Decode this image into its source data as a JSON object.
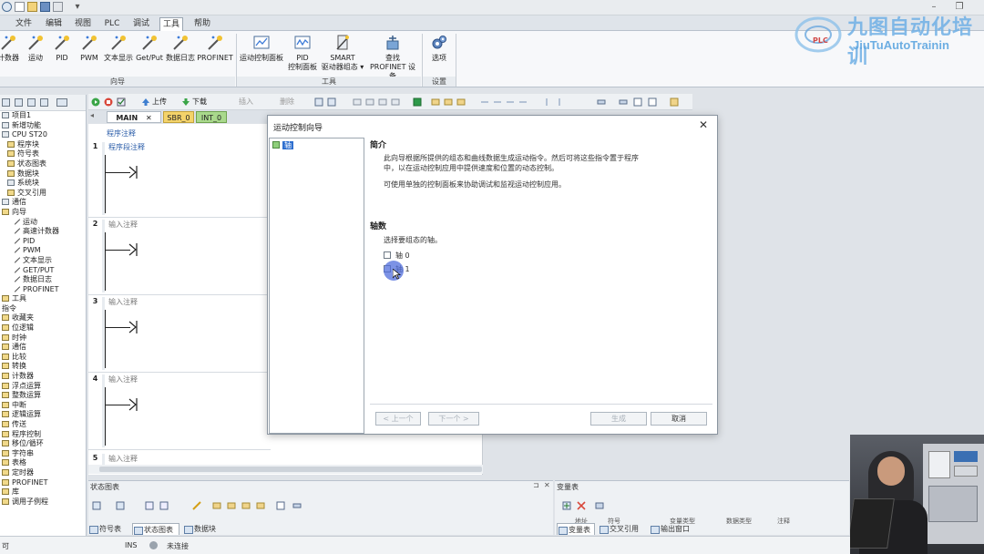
{
  "menu": {
    "tabs": [
      "文件",
      "编辑",
      "视图",
      "PLC",
      "调试",
      "工具",
      "帮助"
    ],
    "active_tab": "工具"
  },
  "ribbon": {
    "wizard_buttons": [
      "计数器",
      "运动",
      "PID",
      "PWM",
      "文本显示",
      "Get/Put",
      "数据日志",
      "PROFINET"
    ],
    "tool_buttons": [
      {
        "line1": "运动控制面板",
        "line2": ""
      },
      {
        "line1": "PID",
        "line2": "控制面板"
      },
      {
        "line1": "SMART",
        "line2": "驱动器组态 ▾"
      },
      {
        "line1": "查找",
        "line2": "PROFINET 设备"
      }
    ],
    "settings_button": "选项",
    "groups": [
      "向导",
      "工具",
      "设置"
    ]
  },
  "logo": {
    "cn": "九图自动化培训",
    "en": "JiuTuAutoTrainin",
    "badge": "PLC"
  },
  "left_tree": {
    "items": [
      {
        "label": "项目1",
        "indent": 0,
        "icon": "plain"
      },
      {
        "label": "新增功能",
        "indent": 0,
        "icon": "plain"
      },
      {
        "label": "CPU ST20",
        "indent": 0,
        "icon": "plain"
      },
      {
        "label": "程序块",
        "indent": 1,
        "icon": "folder"
      },
      {
        "label": "符号表",
        "indent": 1,
        "icon": "folder"
      },
      {
        "label": "状态图表",
        "indent": 1,
        "icon": "folder"
      },
      {
        "label": "数据块",
        "indent": 1,
        "icon": "folder"
      },
      {
        "label": "系统块",
        "indent": 1,
        "icon": "plain"
      },
      {
        "label": "交叉引用",
        "indent": 1,
        "icon": "folder"
      },
      {
        "label": "通信",
        "indent": 0,
        "icon": "plain"
      },
      {
        "label": "向导",
        "indent": 0,
        "icon": "folder"
      },
      {
        "label": "运动",
        "indent": 2,
        "icon": "wand"
      },
      {
        "label": "高速计数器",
        "indent": 2,
        "icon": "wand"
      },
      {
        "label": "PID",
        "indent": 2,
        "icon": "wand"
      },
      {
        "label": "PWM",
        "indent": 2,
        "icon": "wand"
      },
      {
        "label": "文本显示",
        "indent": 2,
        "icon": "wand"
      },
      {
        "label": "GET/PUT",
        "indent": 2,
        "icon": "wand"
      },
      {
        "label": "数据日志",
        "indent": 2,
        "icon": "wand"
      },
      {
        "label": "PROFINET",
        "indent": 2,
        "icon": "wand"
      },
      {
        "label": "工具",
        "indent": 0,
        "icon": "folder"
      },
      {
        "label": "指令",
        "indent": 0,
        "icon": "none"
      },
      {
        "label": "收藏夹",
        "indent": 0,
        "icon": "folder"
      },
      {
        "label": "位逻辑",
        "indent": 0,
        "icon": "folder"
      },
      {
        "label": "时钟",
        "indent": 0,
        "icon": "folder"
      },
      {
        "label": "通信",
        "indent": 0,
        "icon": "folder"
      },
      {
        "label": "比较",
        "indent": 0,
        "icon": "folder"
      },
      {
        "label": "转换",
        "indent": 0,
        "icon": "folder"
      },
      {
        "label": "计数器",
        "indent": 0,
        "icon": "folder"
      },
      {
        "label": "浮点运算",
        "indent": 0,
        "icon": "folder"
      },
      {
        "label": "整数运算",
        "indent": 0,
        "icon": "folder"
      },
      {
        "label": "中断",
        "indent": 0,
        "icon": "folder"
      },
      {
        "label": "逻辑运算",
        "indent": 0,
        "icon": "folder"
      },
      {
        "label": "传送",
        "indent": 0,
        "icon": "folder"
      },
      {
        "label": "程序控制",
        "indent": 0,
        "icon": "folder"
      },
      {
        "label": "移位/循环",
        "indent": 0,
        "icon": "folder"
      },
      {
        "label": "字符串",
        "indent": 0,
        "icon": "folder"
      },
      {
        "label": "表格",
        "indent": 0,
        "icon": "folder"
      },
      {
        "label": "定时器",
        "indent": 0,
        "icon": "folder"
      },
      {
        "label": "PROFINET",
        "indent": 0,
        "icon": "folder"
      },
      {
        "label": "库",
        "indent": 0,
        "icon": "folder"
      },
      {
        "label": "调用子例程",
        "indent": 0,
        "icon": "folder"
      }
    ]
  },
  "editor_toolbar": {
    "upload": "上传",
    "download": "下载",
    "insert": "插入",
    "delete": "删除"
  },
  "doc_tabs": [
    "MAIN",
    "SBR_0",
    "INT_0"
  ],
  "editor": {
    "program_comment": "程序注释",
    "networks": [
      {
        "num": "1",
        "comment": "程序段注释"
      },
      {
        "num": "2",
        "comment": "输入注释"
      },
      {
        "num": "3",
        "comment": "输入注释"
      },
      {
        "num": "4",
        "comment": "输入注释"
      },
      {
        "num": "5",
        "comment": "输入注释"
      }
    ]
  },
  "dialog": {
    "title": "运动控制向导",
    "close": "✕",
    "tree_item": "轴",
    "intro_title": "简介",
    "intro_p1_l1": "此向导根据所提供的组态和曲线数据生成运动指令。然后可将这些指令置于程序",
    "intro_p1_l2": "中，以在运动控制应用中提供速度和位置的动态控制。",
    "intro_p2": "可使用单独的控制面板来协助调试和监视运动控制应用。",
    "axes_title": "轴数",
    "axes_prompt": "选择要组态的轴。",
    "axis0": "轴 0",
    "axis1": "轴 1",
    "btn_prev": "< 上一个",
    "btn_next": "下一个 >",
    "btn_generate": "生成",
    "btn_cancel": "取消"
  },
  "bottom_left": {
    "title": "状态图表",
    "tabs": [
      "符号表",
      "状态图表",
      "数据块"
    ],
    "active_tab": "状态图表"
  },
  "bottom_right": {
    "title": "变量表",
    "header_cols": [
      "地址",
      "符号",
      "变量类型",
      "数据类型",
      "注释"
    ],
    "tabs": [
      "变量表",
      "交叉引用",
      "输出窗口"
    ],
    "active_tab": "变量表"
  },
  "statusbar": {
    "left_text": "可",
    "ins": "INS",
    "connection": "未连接"
  },
  "colors": {
    "accent_blue": "#2f6fcf",
    "ribbon_bg": "#f7f8fa",
    "logo_blue": "#6fb0e6"
  }
}
